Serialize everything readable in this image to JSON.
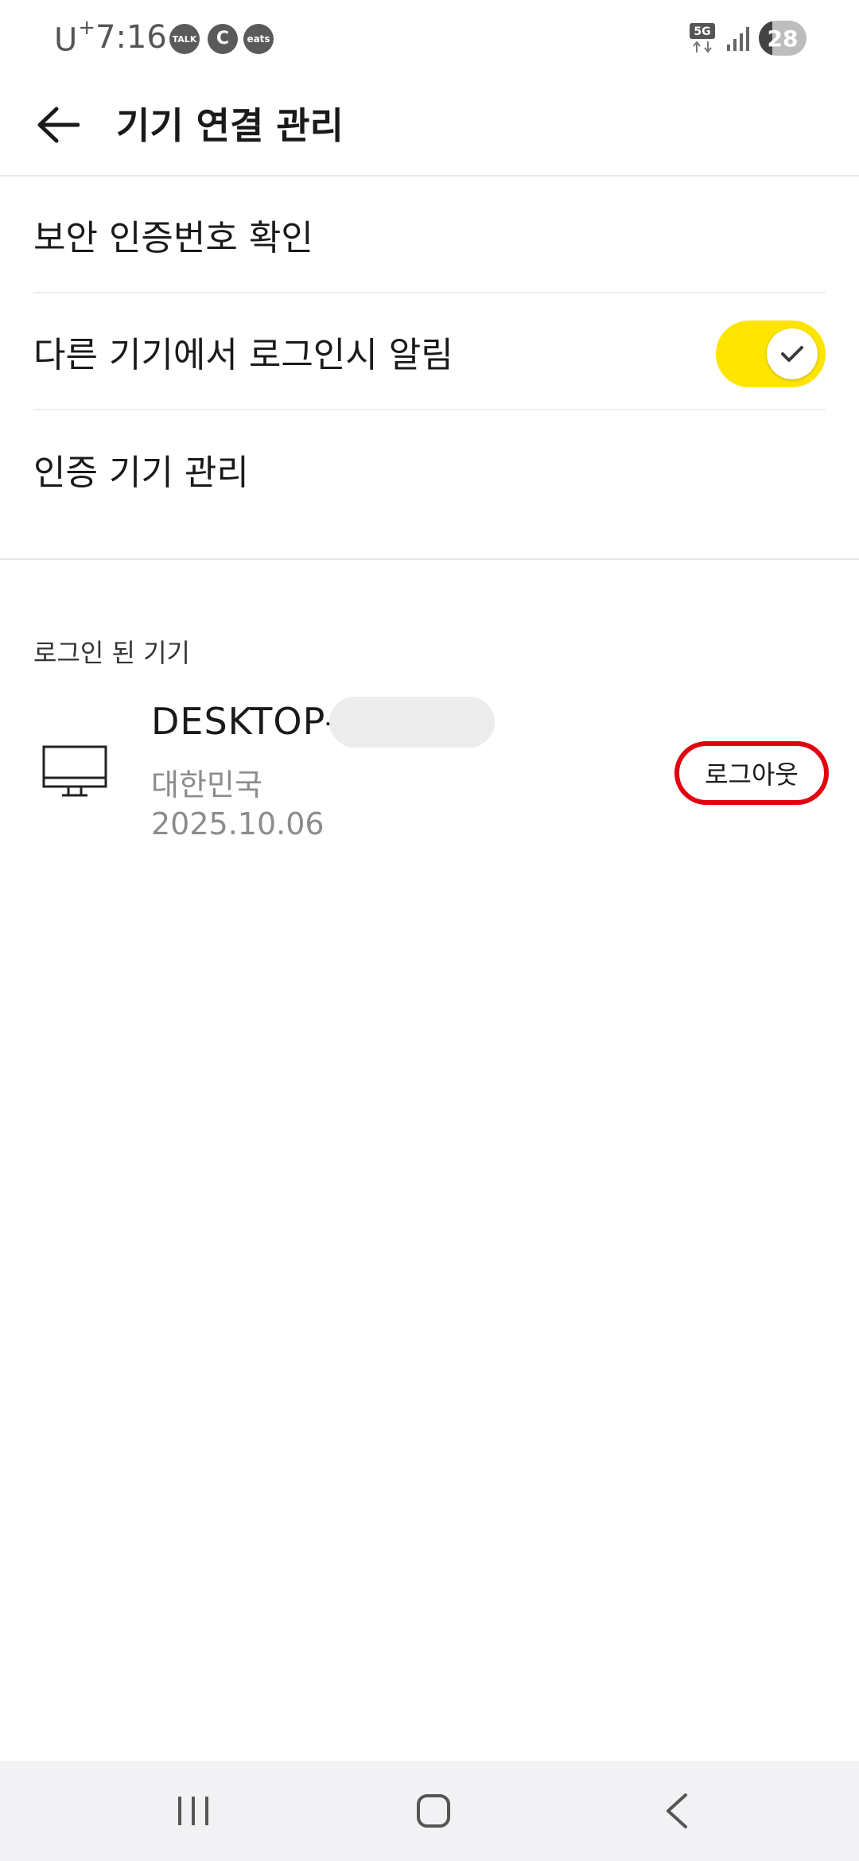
{
  "status_bar": {
    "carrier": "U",
    "carrier_sup": "+",
    "time": "7:16",
    "notifications": [
      {
        "icon": "kakaotalk-icon",
        "text": "TALK"
      },
      {
        "icon": "coupang-icon",
        "text": "C"
      },
      {
        "icon": "coupang-eats-icon",
        "text": "eats"
      }
    ],
    "network": "5G",
    "battery": "28"
  },
  "app_bar": {
    "back_icon": "arrow-left-icon",
    "title": "기기 연결 관리"
  },
  "settings": {
    "items": [
      {
        "label": "보안 인증번호 확인"
      },
      {
        "label": "다른 기기에서 로그인시 알림",
        "toggle_on": true
      },
      {
        "label": "인증 기기 관리"
      }
    ]
  },
  "colors": {
    "toggle_on": "#fee500",
    "highlight_ring": "#e3000f"
  },
  "logged_in": {
    "header": "로그인 된 기기",
    "devices": [
      {
        "icon": "desktop-monitor-icon",
        "name": "DESKTOP-",
        "country": "대한민국",
        "date": "2025.10.06",
        "logout_label": "로그아웃"
      }
    ]
  },
  "nav_bar": {
    "recents_icon": "recent-apps-icon",
    "home_icon": "home-icon",
    "back_icon": "nav-back-icon"
  }
}
